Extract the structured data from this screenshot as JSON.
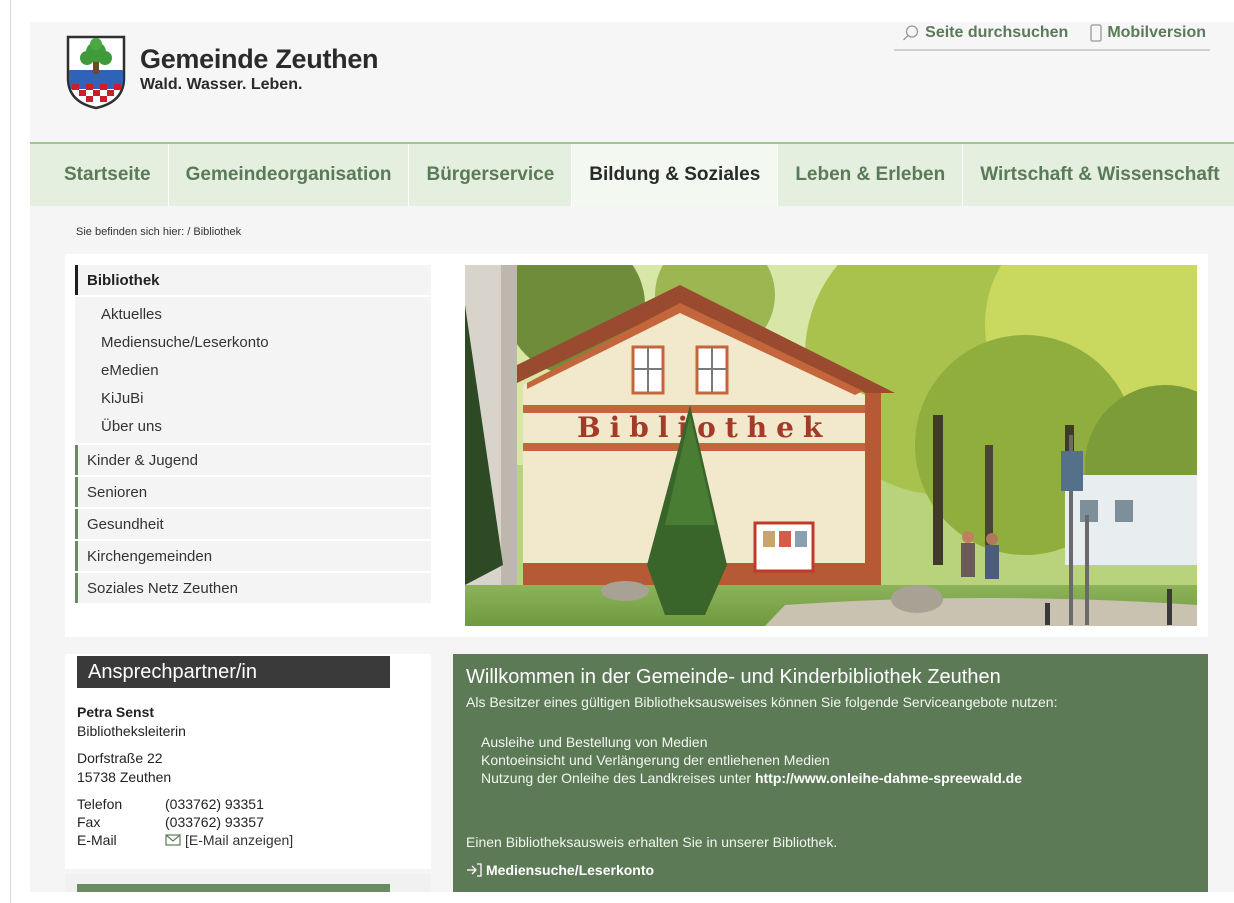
{
  "header": {
    "site_title": "Gemeinde Zeuthen",
    "site_slogan": "Wald. Wasser. Leben.",
    "search_label": "Seite durchsuchen",
    "mobile_label": "Mobilversion",
    "logo_icon": "coat-of-arms-tree-icon"
  },
  "nav": {
    "items": [
      {
        "label": "Startseite",
        "active": false
      },
      {
        "label": "Gemeindeorganisation",
        "active": false
      },
      {
        "label": "Bürgerservice",
        "active": false
      },
      {
        "label": "Bildung & Soziales",
        "active": true
      },
      {
        "label": "Leben & Erleben",
        "active": false
      },
      {
        "label": "Wirtschaft & Wissenschaft",
        "active": false
      }
    ]
  },
  "breadcrumb": "Sie befinden sich hier: / Bibliothek",
  "sidebar": {
    "active": "Bibliothek",
    "subitems": [
      "Aktuelles",
      "Mediensuche/Leserkonto",
      "eMedien",
      "KiJuBi",
      "Über uns"
    ],
    "items": [
      "Kinder & Jugend",
      "Senioren",
      "Gesundheit",
      "Kirchengemeinden",
      "Soziales Netz Zeuthen"
    ]
  },
  "hero": {
    "sign_text": "Bibliothek"
  },
  "contact": {
    "heading": "Ansprechpartner/in",
    "name": "Petra Senst",
    "role": "Bibliotheksleiterin",
    "street": "Dorfstraße 22",
    "city": "15738 Zeuthen",
    "phone_label": "Telefon",
    "phone": "(033762) 93351",
    "fax_label": "Fax",
    "fax": "(033762) 93357",
    "email_label": "E-Mail",
    "email_link": "[E-Mail anzeigen]"
  },
  "welcome": {
    "title": "Willkommen in der Gemeinde- und Kinderbibliothek Zeuthen",
    "intro": "Als Besitzer eines gültigen Bibliotheksausweises können Sie folgende Serviceangebote nutzen:",
    "services": [
      "Ausleihe und Bestellung von Medien",
      "Kontoeinsicht und Verlängerung der entliehenen Medien",
      "Nutzung der Onleihe des Landkreises unter"
    ],
    "service_link": "http://www.onleihe-dahme-spreewald.de",
    "note": "Einen Bibliotheksausweis erhalten Sie in unserer Bibliothek.",
    "link": "Mediensuche/Leserkonto"
  },
  "colors": {
    "brand_green": "#5b7a57",
    "nav_background": "#e4efdf",
    "welcome_background": "#5c7a56",
    "contact_header": "#3a3a3a"
  }
}
